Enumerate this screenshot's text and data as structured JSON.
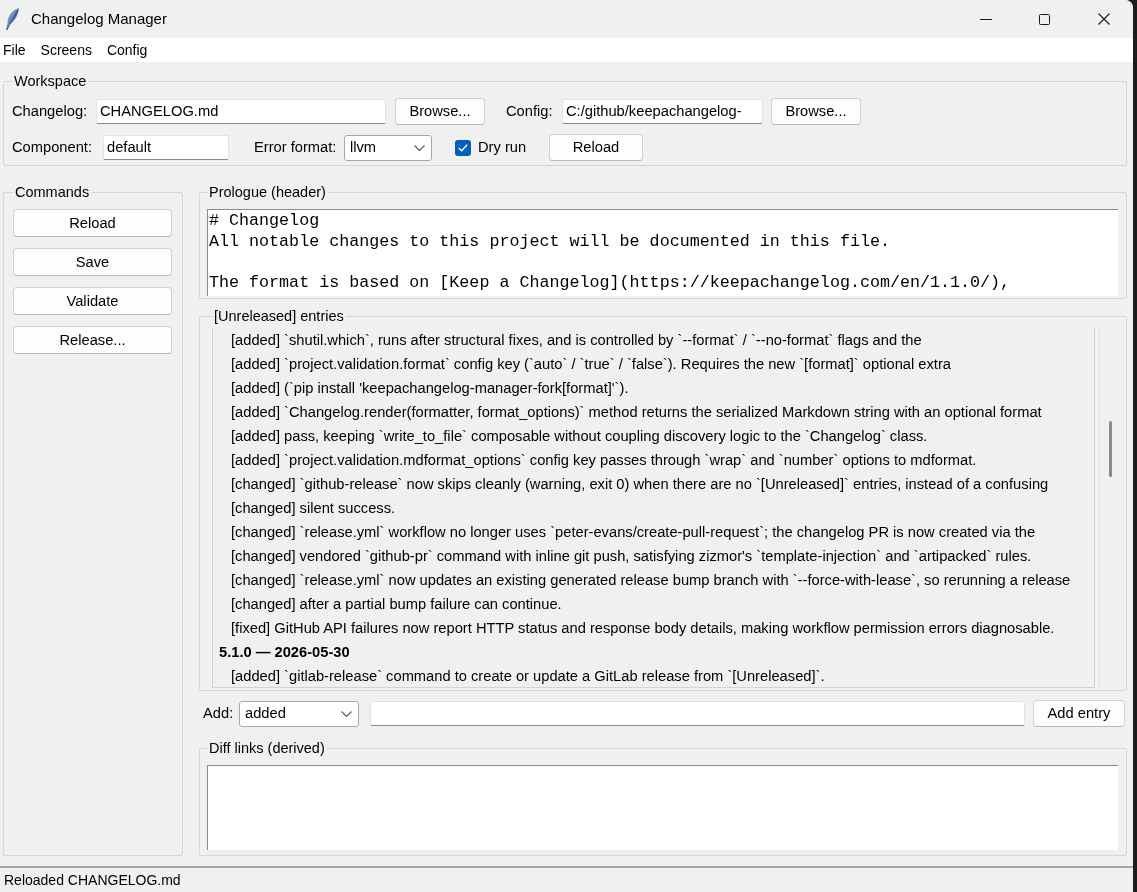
{
  "window": {
    "title": "Changelog Manager"
  },
  "menu": [
    "File",
    "Screens",
    "Config"
  ],
  "workspace": {
    "title": "Workspace",
    "changelog": {
      "label": "Changelog:",
      "value": "CHANGELOG.md",
      "button": "Browse..."
    },
    "config": {
      "label": "Config:",
      "value": "C:/github/keepachangelog-",
      "button": "Browse..."
    },
    "component": {
      "label": "Component:",
      "value": "default"
    },
    "error_format": {
      "label": "Error format:",
      "value": "llvm"
    },
    "dry_run": {
      "label": "Dry run",
      "checked": true
    },
    "reload_button": "Reload"
  },
  "commands": {
    "title": "Commands",
    "buttons": [
      "Reload",
      "Save",
      "Validate",
      "Release..."
    ]
  },
  "prologue": {
    "title": "Prologue (header)",
    "paragraphs": [
      [
        "# Changelog",
        "All notable changes to this project will be documented in this file."
      ],
      [
        "The format is based on [Keep a Changelog](https://keepachangelog.com/en/1.1.0/),"
      ]
    ]
  },
  "unreleased": {
    "title": "[Unreleased] entries",
    "sections": [
      {
        "children": [
          "[added] `shutil.which`, runs after structural fixes, and is controlled by `--format` / `--no-format` flags and the",
          "[added] `project.validation.format` config key (`auto` / `true` / `false`). Requires the new `[format]` optional extra",
          "[added] (`pip install 'keepachangelog-manager-fork[format]'`).",
          "[added] `Changelog.render(formatter, format_options)` method returns the serialized Markdown string with an optional format",
          "[added] pass, keeping `write_to_file` composable without coupling discovery logic to the `Changelog` class.",
          "[added] `project.validation.mdformat_options` config key passes through `wrap` and `number` options to mdformat.",
          "[changed] `github-release` now skips cleanly (warning, exit 0) when there are no `[Unreleased]` entries, instead of a confusing",
          "[changed] silent success.",
          "[changed] `release.yml` workflow no longer uses `peter-evans/create-pull-request`; the changelog PR is now created via the",
          "[changed] vendored `github-pr` command with inline git push, satisfying zizmor's `template-injection` and `artipacked` rules.",
          "[changed] `release.yml` now updates an existing generated release bump branch with `--force-with-lease`, so rerunning a release",
          "[changed] after a partial bump failure can continue.",
          "[fixed] GitHub API failures now report HTTP status and response body details, making workflow permission errors diagnosable."
        ]
      },
      {
        "title": "5.1.0 — 2026-05-30",
        "children": [
          "[added] `gitlab-release` command to create or update a GitLab release from `[Unreleased]`."
        ]
      }
    ]
  },
  "add": {
    "label": "Add:",
    "type": "added",
    "button": "Add entry"
  },
  "diff_links": {
    "title": "Diff links (derived)"
  },
  "status_bar": "Reloaded CHANGELOG.md"
}
